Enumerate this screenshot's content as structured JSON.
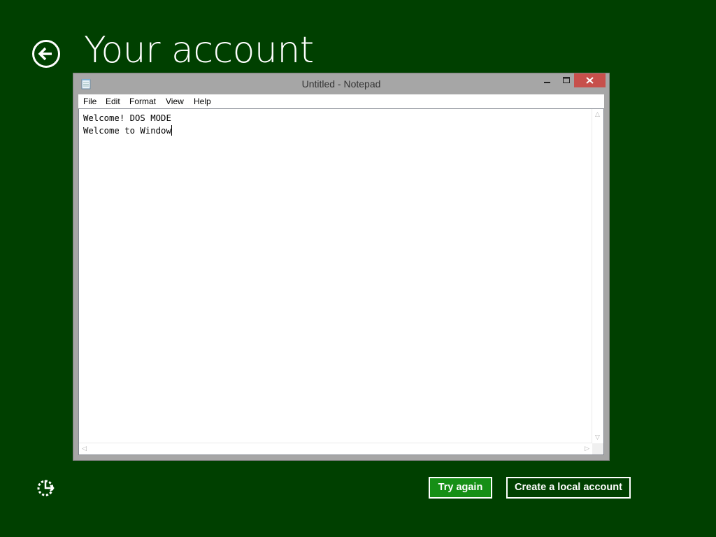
{
  "page": {
    "title": "Your account",
    "background_color": "#004000"
  },
  "notepad": {
    "window_title": "Untitled - Notepad",
    "menu": [
      "File",
      "Edit",
      "Format",
      "View",
      "Help"
    ],
    "text_lines": [
      "Welcome! DOS MODE",
      "Welcome to Window"
    ]
  },
  "buttons": {
    "try_again": "Try again",
    "create_local": "Create a local account"
  },
  "icons": {
    "back": "back-arrow-icon",
    "ease_of_access": "ease-of-access-icon",
    "notepad": "notepad-icon",
    "minimize": "minimize-icon",
    "maximize": "maximize-icon",
    "close": "close-icon"
  },
  "colors": {
    "accent_button": "#168f16",
    "close_button": "#c7504b"
  }
}
